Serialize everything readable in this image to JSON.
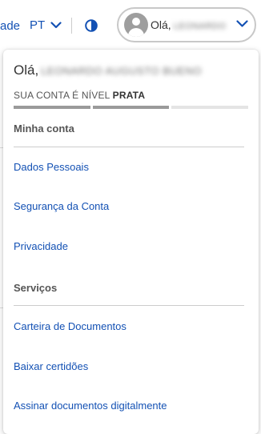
{
  "header": {
    "partial_link": "ade",
    "language": "PT",
    "contrast_icon": "contrast-icon",
    "user_greeting": "Olá,",
    "user_name": "LEONARDO"
  },
  "dropdown": {
    "greeting": "Olá,",
    "full_name": "LEONARDO AUGUSTO BUENO",
    "level_prefix": "SUA CONTA É NÍVEL ",
    "level_value": "PRATA",
    "level_progress": "2 of 3 segments filled",
    "sections": [
      {
        "title": "Minha conta",
        "items": [
          "Dados Pessoais",
          "Segurança da Conta",
          "Privacidade"
        ]
      },
      {
        "title": "Serviços",
        "items": [
          "Carteira de Documentos",
          "Baixar certidões",
          "Assinar documentos digitalmente"
        ]
      }
    ]
  },
  "colors": {
    "link": "#1351b4",
    "text": "#333333",
    "muted": "#555555",
    "progress_on": "#9a9a9a",
    "progress_off": "#e4e4e4"
  }
}
